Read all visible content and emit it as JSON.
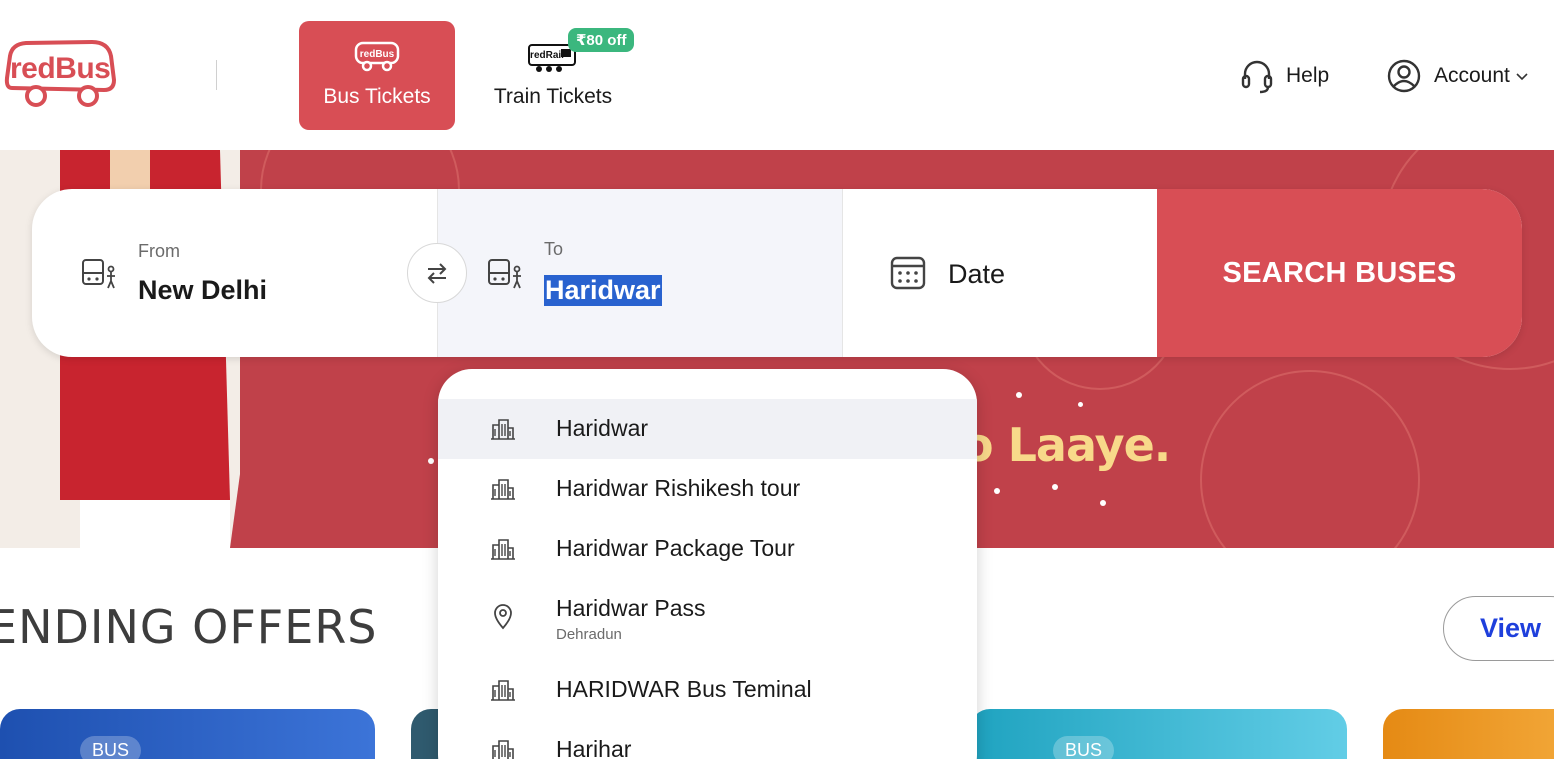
{
  "header": {
    "logo_text": "redBus",
    "tabs": [
      {
        "label": "Bus Tickets",
        "icon_text": "redBus",
        "active": true
      },
      {
        "label": "Train Tickets",
        "icon_text": "redRail",
        "badge": "₹80 off",
        "active": false
      }
    ],
    "help_label": "Help",
    "account_label": "Account"
  },
  "banner": {
    "slogan": "o Laaye."
  },
  "search": {
    "from_label": "From",
    "from_value": "New Delhi",
    "to_label": "To",
    "to_value": "Haridwar",
    "date_label": "Date",
    "button_label": "SEARCH BUSES"
  },
  "dropdown": {
    "items": [
      {
        "name": "Haridwar",
        "sub": "",
        "icon": "city-icon",
        "active": true
      },
      {
        "name": "Haridwar Rishikesh tour",
        "sub": "",
        "icon": "city-icon",
        "active": false
      },
      {
        "name": "Haridwar Package Tour",
        "sub": "",
        "icon": "city-icon",
        "active": false
      },
      {
        "name": "Haridwar Pass",
        "sub": "Dehradun",
        "icon": "location-pin-icon",
        "active": false
      },
      {
        "name": "HARIDWAR Bus Teminal",
        "sub": "",
        "icon": "city-icon",
        "active": false
      },
      {
        "name": "Harihar",
        "sub": "",
        "icon": "city-icon",
        "active": false
      }
    ]
  },
  "offers": {
    "title": "ENDING OFFERS",
    "view_label": "View",
    "cards": [
      {
        "tag": "BUS"
      },
      {
        "tag": ""
      },
      {
        "tag": "BUS"
      },
      {
        "tag": ""
      }
    ]
  },
  "colors": {
    "brand": "#d84e55",
    "banner": "#c0414a",
    "badge": "#3bb77e",
    "selection": "#2962cf",
    "link": "#1e3fdc"
  }
}
